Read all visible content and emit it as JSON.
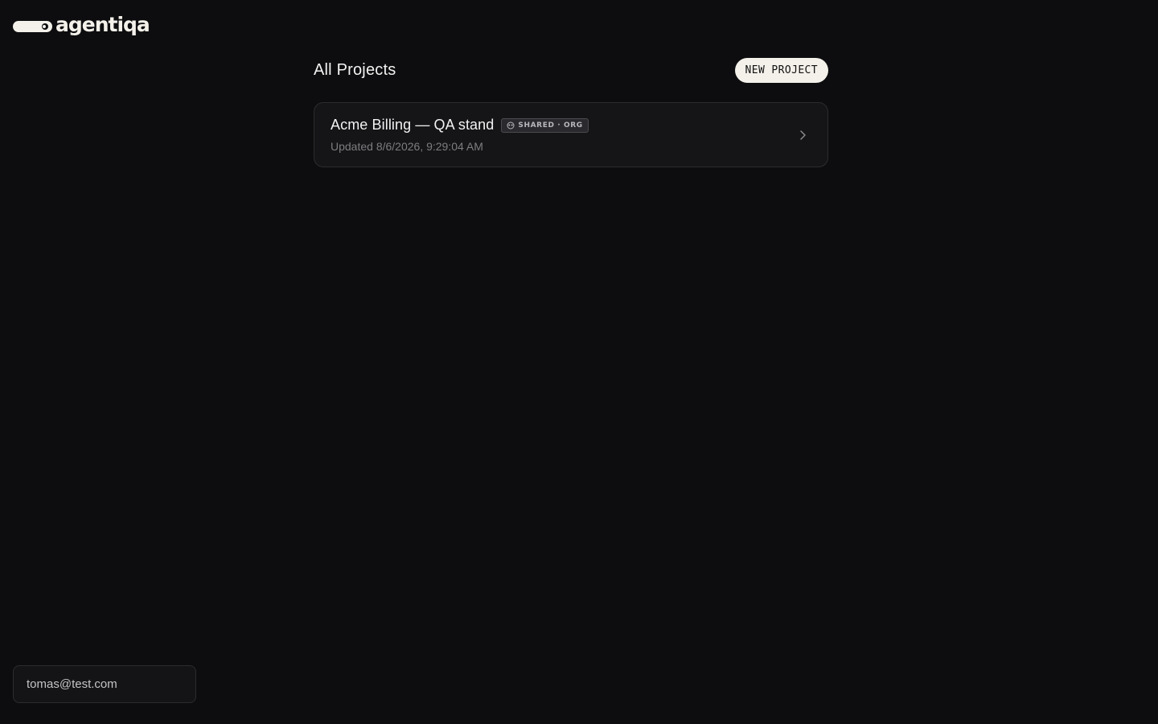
{
  "brand": {
    "name": "agentiqa",
    "logo_icon": "agentiqa-logo-icon"
  },
  "header": {
    "title": "All Projects",
    "new_project_label": "NEW PROJECT"
  },
  "projects": [
    {
      "name": "Acme Billing — QA stand",
      "badge": "SHARED · ORG",
      "badge_icon": "org-icon",
      "updated": "Updated 8/6/2026, 9:29:04 AM",
      "icon": "chevron-right-icon"
    }
  ],
  "user": {
    "email": "tomas@test.com"
  },
  "colors": {
    "background": "#0d0d0f",
    "accent": "#f4f1ea",
    "card_border": "#2c2c30"
  }
}
